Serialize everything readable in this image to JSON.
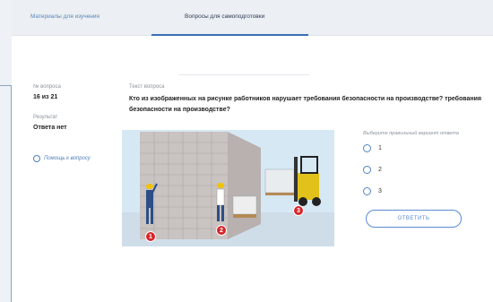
{
  "tabs": [
    {
      "label": "Материалы для изучения",
      "active": false
    },
    {
      "label": "Вопросы для самоподготовки",
      "active": true
    }
  ],
  "sidebar": {
    "question_number_label": "№ вопроса",
    "question_number_value": "16 из 21",
    "result_label": "Результат",
    "result_value": "Ответа нет",
    "help_link": "Помощь к вопросу"
  },
  "question": {
    "label": "Текст вопроса",
    "text": "Кто из изображенных на рисунке работников нарушает требования безопасности на производстве? требования безопасности на производстве?"
  },
  "image": {
    "markers": [
      "1",
      "2",
      "3"
    ]
  },
  "answers": {
    "hint": "Выберите правильный вариант ответа",
    "options": [
      "1",
      "2",
      "3"
    ],
    "submit_label": "ОТВЕТИТЬ"
  },
  "colors": {
    "accent": "#3b6fb5",
    "marker": "#d6262b",
    "link": "#4f7fb8"
  }
}
